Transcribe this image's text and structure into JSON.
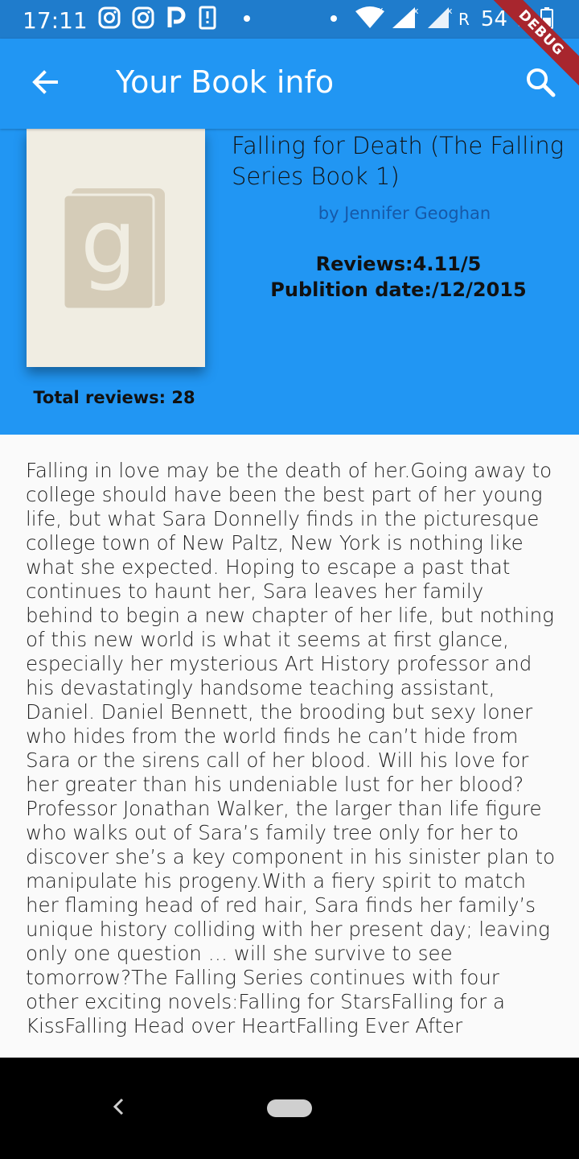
{
  "status_bar": {
    "time": "17:11",
    "battery": "54 %",
    "network_label": "R",
    "icons": [
      "instagram-icon",
      "instagram-icon",
      "parking-app-icon",
      "phone-notification-icon",
      "dot-icon",
      "dot-icon",
      "wifi-icon",
      "signal-icon",
      "signal-icon",
      "battery-icon"
    ]
  },
  "debug_banner": "DEBUG",
  "app_bar": {
    "title": "Your Book info",
    "back_icon": "arrow-back-icon",
    "search_icon": "search-icon"
  },
  "book": {
    "title": "Falling for Death (The Falling Series Book 1)",
    "author": "by Jennifer Geoghan",
    "reviews": "Reviews:4.11/5",
    "publication": "Publition date:/12/2015",
    "total_reviews": "Total reviews: 28",
    "cover_icon": "goodreads-book-icon",
    "description": "Falling in love may be the death of her.Going away to college should have been the best part of her young life, but what Sara Donnelly finds in the picturesque college town of New Paltz, New York is nothing like what she expected. Hoping to escape a past that continues to haunt her, Sara leaves her family behind to begin a new chapter of her life, but nothing of this new world is what it seems at first glance, especially her mysterious Art History professor and his devastatingly handsome teaching assistant, Daniel. Daniel Bennett, the brooding but sexy loner who hides from the world finds he can’t hide from Sara or the sirens call of her blood. Will his love for her greater than his undeniable lust for her blood? Professor Jonathan Walker, the larger than life figure who walks out of Sara’s family tree only for her to discover she’s a key component in his sinister plan to manipulate his progeny.With a fiery spirit to match her flaming head of red hair, Sara finds her family’s unique history colliding with her present day; leaving only one question … will she survive to see tomorrow?The Falling Series continues with four other exciting novels:Falling for StarsFalling for a KissFalling Head over HeartFalling Ever After"
  },
  "colors": {
    "primary": "#2196f3",
    "status_bar": "#1f7ccc",
    "author_text": "#1659a8",
    "cover_bg": "#f0ede2",
    "cover_icon": "#d9d0bd",
    "debug_banner": "#a8262e"
  },
  "nav_bar": {
    "back_icon": "nav-back-icon",
    "home_icon": "nav-home-pill-icon"
  }
}
